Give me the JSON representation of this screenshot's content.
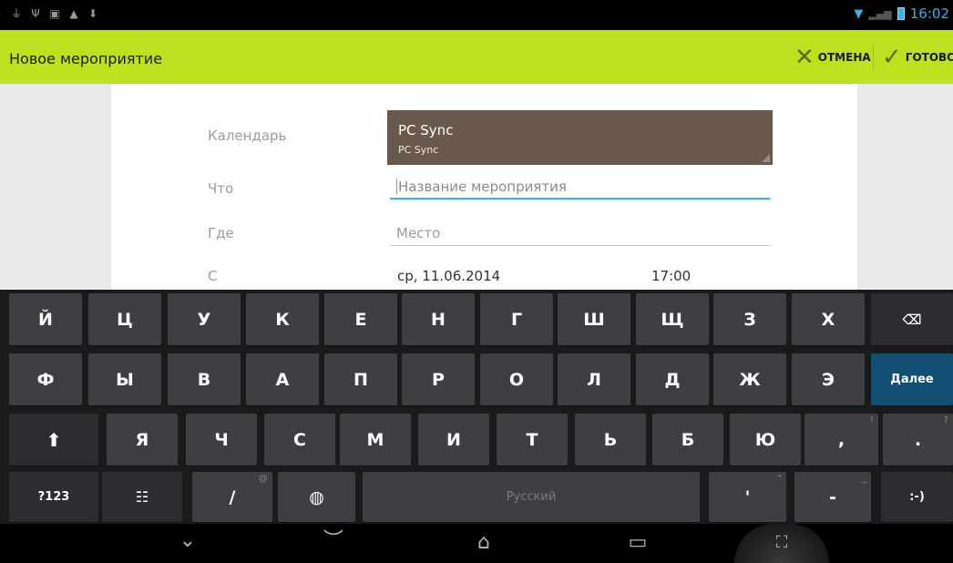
{
  "status_bar": {
    "left_icons": [
      "usb-icon",
      "usb-debug-icon",
      "picture-icon",
      "warning-icon",
      "download-icon"
    ],
    "time": "16:02"
  },
  "action_bar": {
    "title": "Новое мероприятие",
    "cancel_label": "ОТМЕНА",
    "done_label": "ГОТОВО",
    "accent_color": "#bde01f"
  },
  "form": {
    "calendar_label": "Календарь",
    "calendar_name": "PC Sync",
    "calendar_account": "PC Sync",
    "what_label": "Что",
    "what_placeholder": "Название мероприятия",
    "where_label": "Где",
    "where_placeholder": "Место",
    "from_label": "С",
    "from_date": "ср, 11.06.2014",
    "from_time": "17:00"
  },
  "keyboard": {
    "row1": [
      "Й",
      "Ц",
      "У",
      "К",
      "Е",
      "Н",
      "Г",
      "Ш",
      "Щ",
      "З",
      "Х"
    ],
    "row2": [
      "Ф",
      "Ы",
      "В",
      "А",
      "П",
      "Р",
      "О",
      "Л",
      "Д",
      "Ж",
      "Э"
    ],
    "row3": [
      "Я",
      "Ч",
      "С",
      "М",
      "И",
      "Т",
      "Ь",
      "Б",
      "Ю"
    ],
    "next_label": "Далее",
    "comma_label": ",",
    "comma_hint": "!",
    "period_label": ".",
    "period_hint": "?",
    "symbols_label": "?123",
    "slash_label": "/",
    "slash_hint": "@",
    "space_label": "Русский",
    "apostrophe_label": "'",
    "apostrophe_hint": "\"",
    "dash_label": "-",
    "dash_hint": "_",
    "smiley_label": ":-)",
    "action_color": "#134f73"
  },
  "nav_bar": {
    "icons": [
      "hide-keyboard-icon",
      "back-icon",
      "home-icon",
      "recent-apps-icon",
      "screenshot-icon"
    ]
  }
}
